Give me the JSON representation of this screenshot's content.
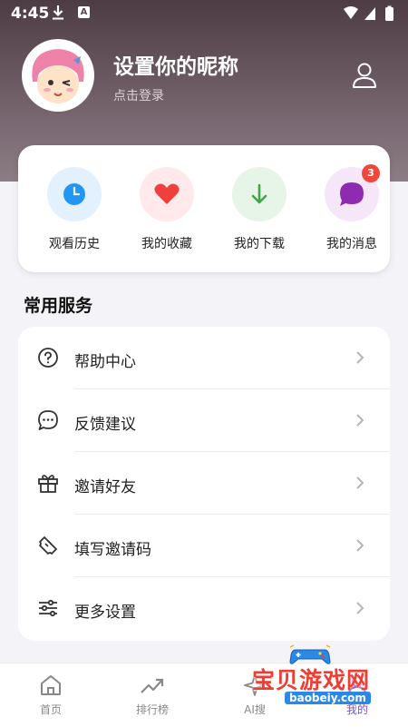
{
  "status_bar": {
    "time": "4:45"
  },
  "profile": {
    "nickname": "设置你的昵称",
    "login_hint": "点击登录"
  },
  "quick_actions": [
    {
      "label": "观看历史",
      "icon": "clock-icon",
      "bg": "#e3f1ff",
      "color": "#2196f3"
    },
    {
      "label": "我的收藏",
      "icon": "heart-icon",
      "bg": "#ffe9ea",
      "color": "#f0403b"
    },
    {
      "label": "我的下载",
      "icon": "download-icon",
      "bg": "#e6f5e7",
      "color": "#43a547"
    },
    {
      "label": "我的消息",
      "icon": "message-icon",
      "bg": "#f5e6f8",
      "color": "#8e2bb0",
      "badge": "3"
    }
  ],
  "services": {
    "title": "常用服务",
    "items": [
      {
        "label": "帮助中心",
        "icon": "help-circle-icon"
      },
      {
        "label": "反馈建议",
        "icon": "chat-dots-icon"
      },
      {
        "label": "邀请好友",
        "icon": "gift-icon"
      },
      {
        "label": "填写邀请码",
        "icon": "ticket-icon"
      },
      {
        "label": "更多设置",
        "icon": "sliders-icon"
      }
    ]
  },
  "tabbar": {
    "items": [
      {
        "label": "首页",
        "icon": "home-icon"
      },
      {
        "label": "排行榜",
        "icon": "trending-icon"
      },
      {
        "label": "AI搜",
        "icon": "sparkle-icon"
      },
      {
        "label": "我的",
        "icon": "profile-icon"
      }
    ]
  },
  "watermark": {
    "title": "宝贝游戏网",
    "url": "baobeiy.com"
  },
  "colors": {
    "hero_top": "#4d3c44",
    "hero_bottom": "#8c7d85",
    "accent_red": "#f0463c"
  }
}
